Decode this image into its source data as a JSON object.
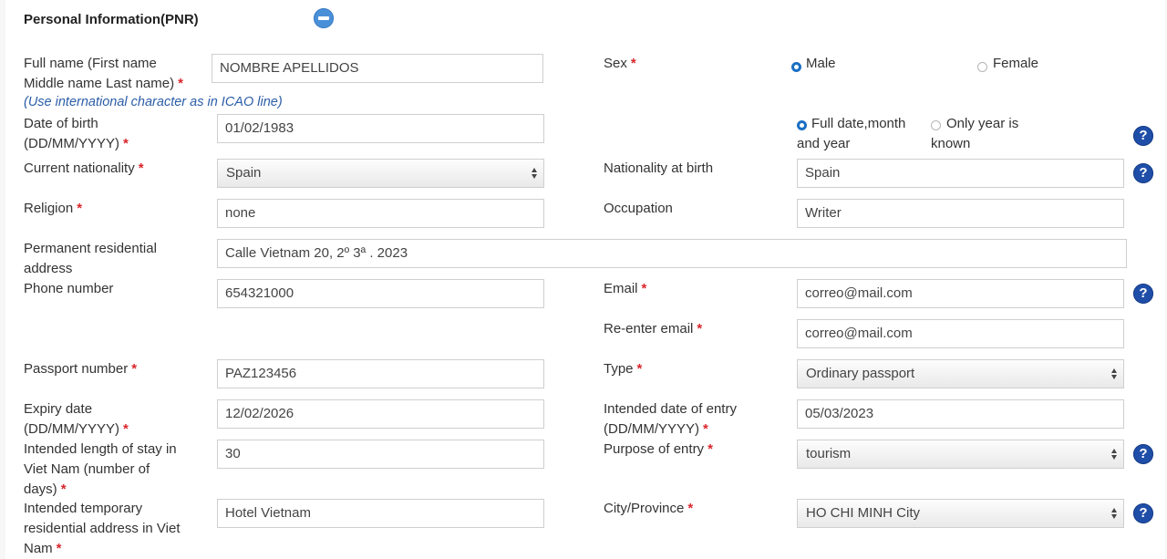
{
  "section": {
    "title": "Personal Information(PNR)"
  },
  "required_mark": "*",
  "help_glyph": "?",
  "full_name": {
    "label": "Full name (First name Middle name Last name)",
    "value": "NOMBRE APELLIDOS",
    "note": "(Use international character as in ICAO line)"
  },
  "sex": {
    "label": "Sex",
    "options": [
      "Male",
      "Female"
    ],
    "selected": "Male"
  },
  "dob": {
    "label": "Date of birth (DD/MM/YYYY)",
    "value": "01/02/1983",
    "options": [
      "Full date,month and year",
      "Only year is known"
    ],
    "selected": "Full date,month and year"
  },
  "current_nationality": {
    "label": "Current nationality",
    "value": "Spain"
  },
  "nationality_at_birth": {
    "label": "Nationality at birth",
    "value": "Spain"
  },
  "religion": {
    "label": "Religion",
    "value": "none"
  },
  "occupation": {
    "label": "Occupation",
    "value": "Writer"
  },
  "address": {
    "label": "Permanent residential address",
    "value": "Calle Vietnam 20, 2º 3ª . 2023"
  },
  "phone": {
    "label": "Phone number",
    "value": "654321000"
  },
  "email": {
    "label": "Email",
    "value": "correo@mail.com"
  },
  "reenter_email": {
    "label": "Re-enter email",
    "value": "correo@mail.com"
  },
  "passport_number": {
    "label": "Passport number",
    "value": "PAZ123456"
  },
  "passport_type": {
    "label": "Type",
    "value": "Ordinary passport"
  },
  "expiry_date": {
    "label": "Expiry date (DD/MM/YYYY)",
    "value": "12/02/2026"
  },
  "entry_date": {
    "label": "Intended date of entry (DD/MM/YYYY)",
    "value": "05/03/2023"
  },
  "stay_length": {
    "label": "Intended length of stay in Viet Nam (number of days)",
    "value": "30"
  },
  "purpose": {
    "label": "Purpose of entry",
    "value": "tourism"
  },
  "temp_address": {
    "label": "Intended temporary residential address in Viet Nam",
    "value": "Hotel Vietnam"
  },
  "city": {
    "label": "City/Province",
    "value": "HO CHI MINH City"
  },
  "colors": {
    "accent": "#1f4ea8",
    "required": "#d9262c",
    "note": "#2a5da8"
  }
}
